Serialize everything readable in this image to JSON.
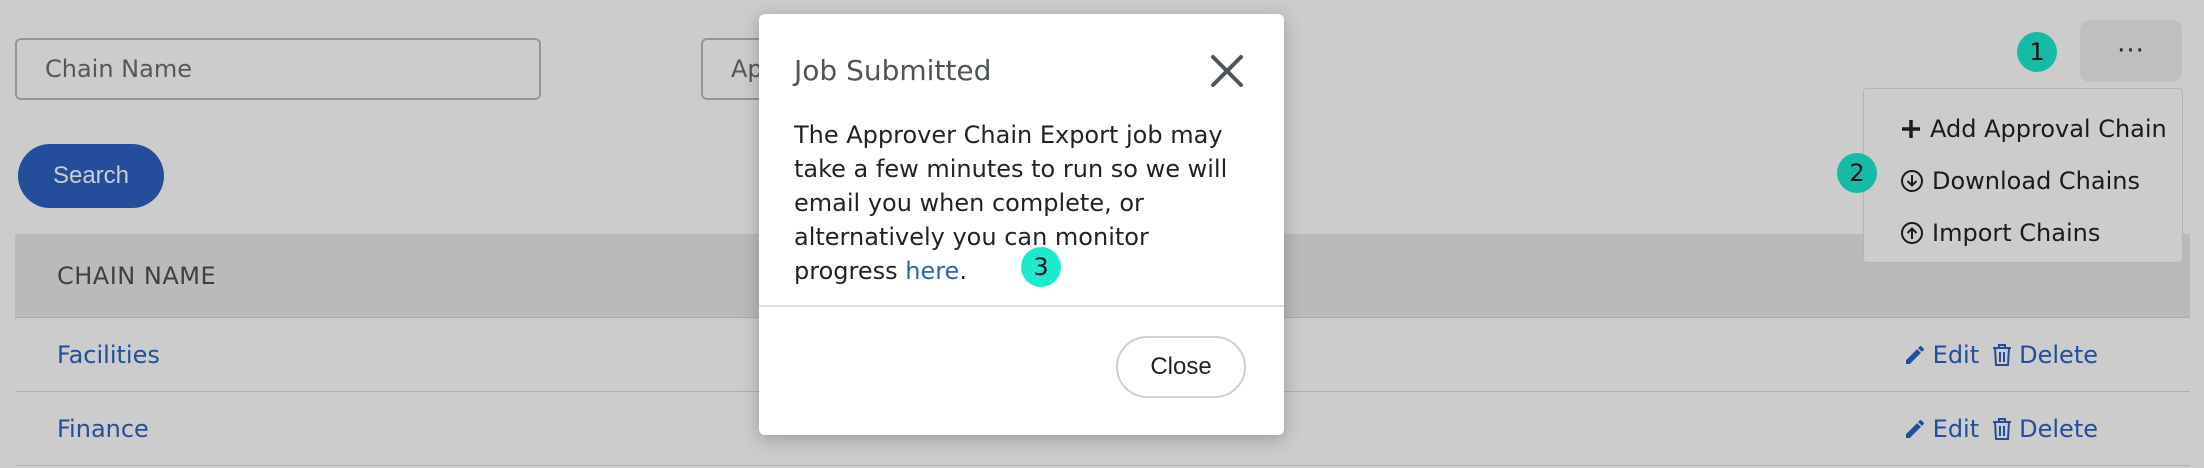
{
  "filters": {
    "chain_name_placeholder": "Chain Name",
    "approver_placeholder_visible": "Ap"
  },
  "search_button_label": "Search",
  "table": {
    "header": "CHAIN NAME",
    "rows": [
      {
        "name": "Facilities",
        "edit": "Edit",
        "delete": "Delete"
      },
      {
        "name": "Finance",
        "edit": "Edit",
        "delete": "Delete"
      }
    ]
  },
  "kebab_label": "···",
  "menu": {
    "items": [
      {
        "label": "Add Approval Chain",
        "icon": "plus-icon"
      },
      {
        "label": "Download Chains",
        "icon": "download-circle-icon"
      },
      {
        "label": "Import Chains",
        "icon": "upload-circle-icon"
      }
    ]
  },
  "markers": [
    "1",
    "2",
    "3"
  ],
  "modal": {
    "title": "Job Submitted",
    "body_text": "The Approver Chain Export job may take a few minutes to run so we will email you when complete, or alternatively you can monitor progress ",
    "link_text": "here",
    "body_suffix": ".",
    "close_label": "Close"
  },
  "colors": {
    "accent": "#2e62c2",
    "marker": "#1de9cf",
    "overlay": "rgba(0,0,0,0.2)"
  }
}
